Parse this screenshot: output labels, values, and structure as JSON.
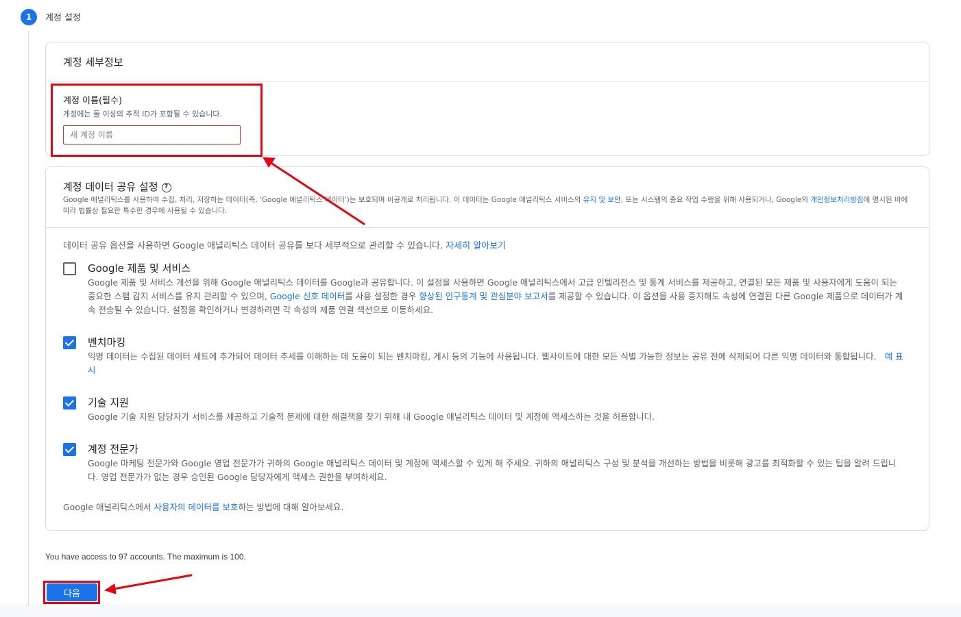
{
  "step": {
    "number": "1",
    "title": "계정 설정"
  },
  "account_details": {
    "title": "계정 세부정보",
    "name_label": "계정 이름(필수)",
    "name_hint": "계정에는 둘 이상의 추적 ID가 포함될 수 있습니다.",
    "name_placeholder": "새 계정 이름",
    "name_value": ""
  },
  "data_sharing": {
    "title": "계정 데이터 공유 설정",
    "help_icon": "help-circle-icon",
    "desc_part1": "Google 애널리틱스를 사용하여 수집, 처리, 저장하는 데이터(즉, 'Google 애널리틱스 데이터')는 보호되며 비공개로 처리됩니다. 이 데이터는 Google 애널리틱스 서비스의 ",
    "desc_link1": "유지 및 보안",
    "desc_part2": ", 또는 시스템의 중요 작업 수행을 위해 사용되거나, Google의 ",
    "desc_link2": "개인정보처리방침",
    "desc_part3": "에 명시된 바에 따라 법률상 필요한 특수한 경우에 사용될 수 있습니다.",
    "intro_text": "데이터 공유 옵션을 사용하면 Google 애널리틱스 데이터 공유를 보다 세부적으로 관리할 수 있습니다. ",
    "intro_link": "자세히 알아보기",
    "options": [
      {
        "title": "Google 제품 및 서비스",
        "checked": false,
        "desc_part1": "Google 제품 및 서비스 개선을 위해 Google 애널리틱스 데이터를 Google과 공유합니다. 이 설정을 사용하면 Google 애널리틱스에서 고급 인텔리전스 및 통계 서비스를 제공하고, 연결된 모든 제품 및 사용자에게 도움이 되는 중요한 스팸 감지 서비스를 유지 관리할 수 있으며, ",
        "link1": "Google 신호 데이터",
        "desc_part2": "를 사용 설정한 경우 ",
        "link2": "향상된 인구통계 및 관심분야 보고서",
        "desc_part3": "를 제공할 수 있습니다. 이 옵션을 사용 중지해도 속성에 연결된 다른 Google 제품으로 데이터가 계속 전송될 수 있습니다. 설정을 확인하거나 변경하려면 각 속성의 제품 연결 섹션으로 이동하세요."
      },
      {
        "title": "벤치마킹",
        "checked": true,
        "desc": "익명 데이터는 수집된 데이터 세트에 추가되어 데이터 추세를 이해하는 데 도움이 되는 벤치마킹, 게시 등의 기능에 사용됩니다. 웹사이트에 대한 모든 식별 가능한 정보는 공유 전에 삭제되어 다른 익명 데이터와 통합됩니다.",
        "link": "예 표시"
      },
      {
        "title": "기술 지원",
        "checked": true,
        "desc": "Google 기술 지원 담당자가 서비스를 제공하고 기술적 문제에 대한 해결책을 찾기 위해 내 Google 애널리틱스 데이터 및 계정에 액세스하는 것을 허용합니다."
      },
      {
        "title": "계정 전문가",
        "checked": true,
        "desc": "Google 마케팅 전문가와 Google 영업 전문가가 귀하의 Google 애널리틱스 데이터 및 계정에 액세스할 수 있게 해 주세요. 귀하의 애널리틱스 구성 및 분석을 개선하는 방법을 비롯해 광고를 최적화할 수 있는 팁을 알려 드립니다. 영업 전문가가 없는 경우 승인된 Google 담당자에게 액세스 권한을 부여하세요."
      }
    ],
    "protect_part1": "Google 애널리틱스에서 ",
    "protect_link": "사용자의 데이터를 보호",
    "protect_part2": "하는 방법에 대해 알아보세요."
  },
  "access_text": "You have access to 97 accounts. The maximum is 100.",
  "next_label": "다음",
  "annotation_color": "#e8040c",
  "accent_color": "#1a73e8"
}
